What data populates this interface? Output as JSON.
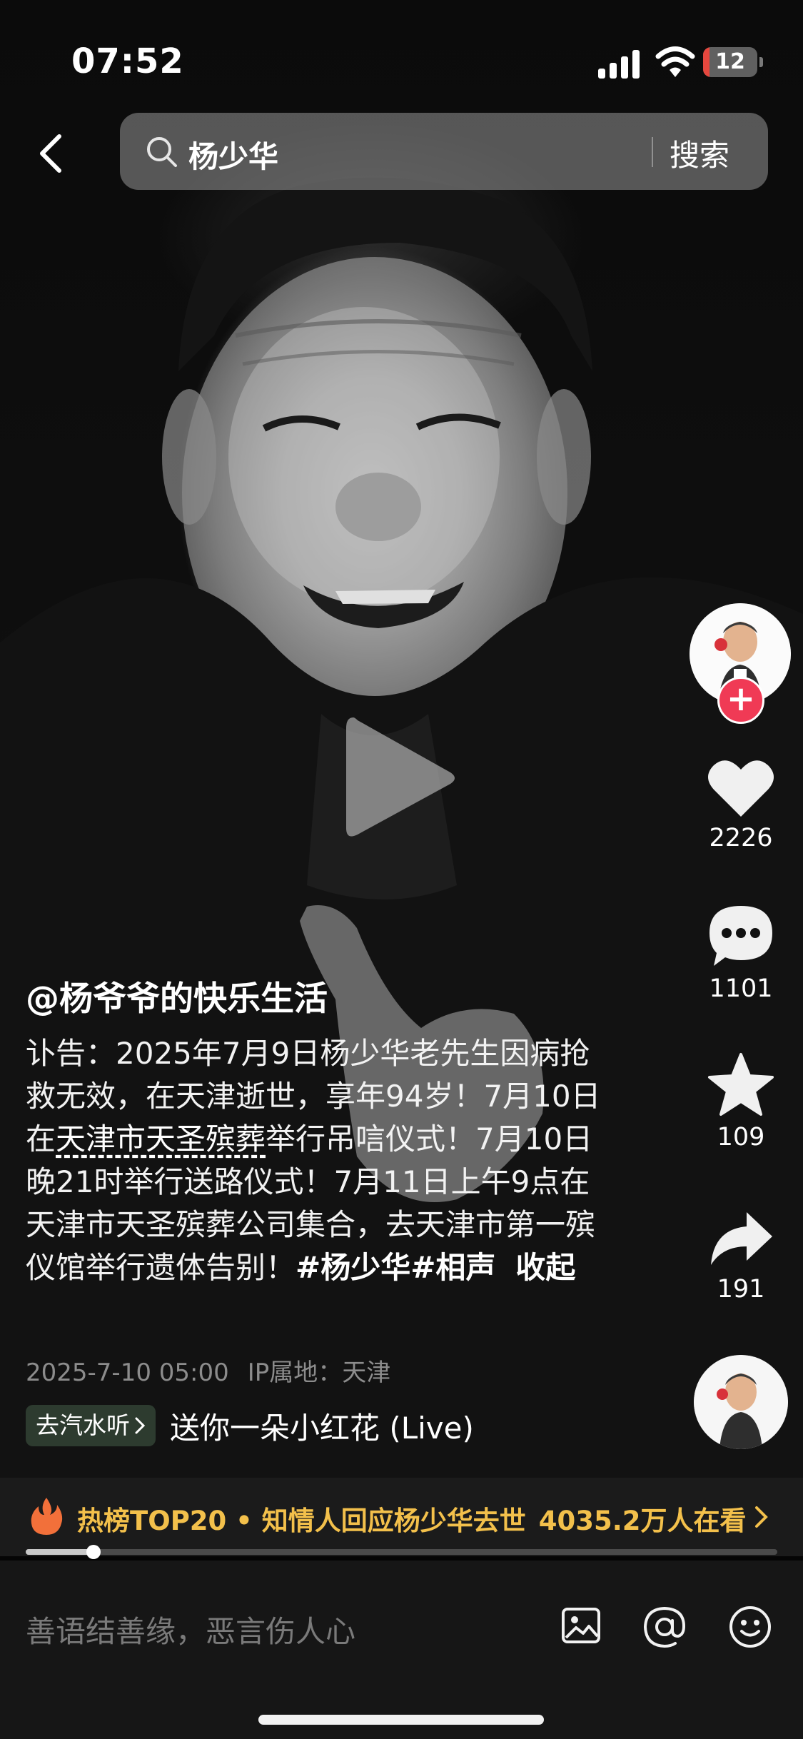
{
  "status_bar": {
    "time": "07:52",
    "battery_level": "12",
    "battery_fraction": 0.12
  },
  "header": {
    "search_query": "杨少华",
    "search_button": "搜索"
  },
  "sidebar": {
    "likes": "2226",
    "comments": "1101",
    "favorites": "109",
    "shares": "191"
  },
  "post": {
    "author": "@杨爷爷的快乐生活",
    "caption_part1": "讣告：2025年7月9日杨少华老先生因病抢救无效，在天津逝世，享年94岁！7月10日在",
    "caption_place": "天津市天圣殡葬",
    "caption_part2": "举行吊唁仪式！7月10日晚21时举行送路仪式！7月11日上午9点在天津市天圣殡葬公司集合，去天津市第一殡仪馆举行遗体告别！",
    "hashtags": [
      "#杨少华",
      "#相声"
    ],
    "collapse_label": "收起",
    "timestamp": "2025-7-10 05:00",
    "ip_location": "IP属地：天津",
    "music_chip": "去汽水听",
    "music_title": "送你一朵小红花 (Live)"
  },
  "hot_banner": {
    "title": "热榜TOP20 • 知情人回应杨少华去世",
    "viewers": "4035.2万人在看"
  },
  "playback": {
    "progress_fraction": 0.09
  },
  "comment_bar": {
    "placeholder": "善语结善缘，恶言伤人心"
  },
  "colors": {
    "accent_red": "#f03a55",
    "hot_yellow": "#f3c04b",
    "battery_red": "#e5473e"
  },
  "icons": [
    "back-icon",
    "search-icon",
    "play-icon",
    "heart-icon",
    "comment-icon",
    "star-icon",
    "share-icon",
    "flame-icon",
    "image-icon",
    "at-icon",
    "emoji-icon"
  ]
}
